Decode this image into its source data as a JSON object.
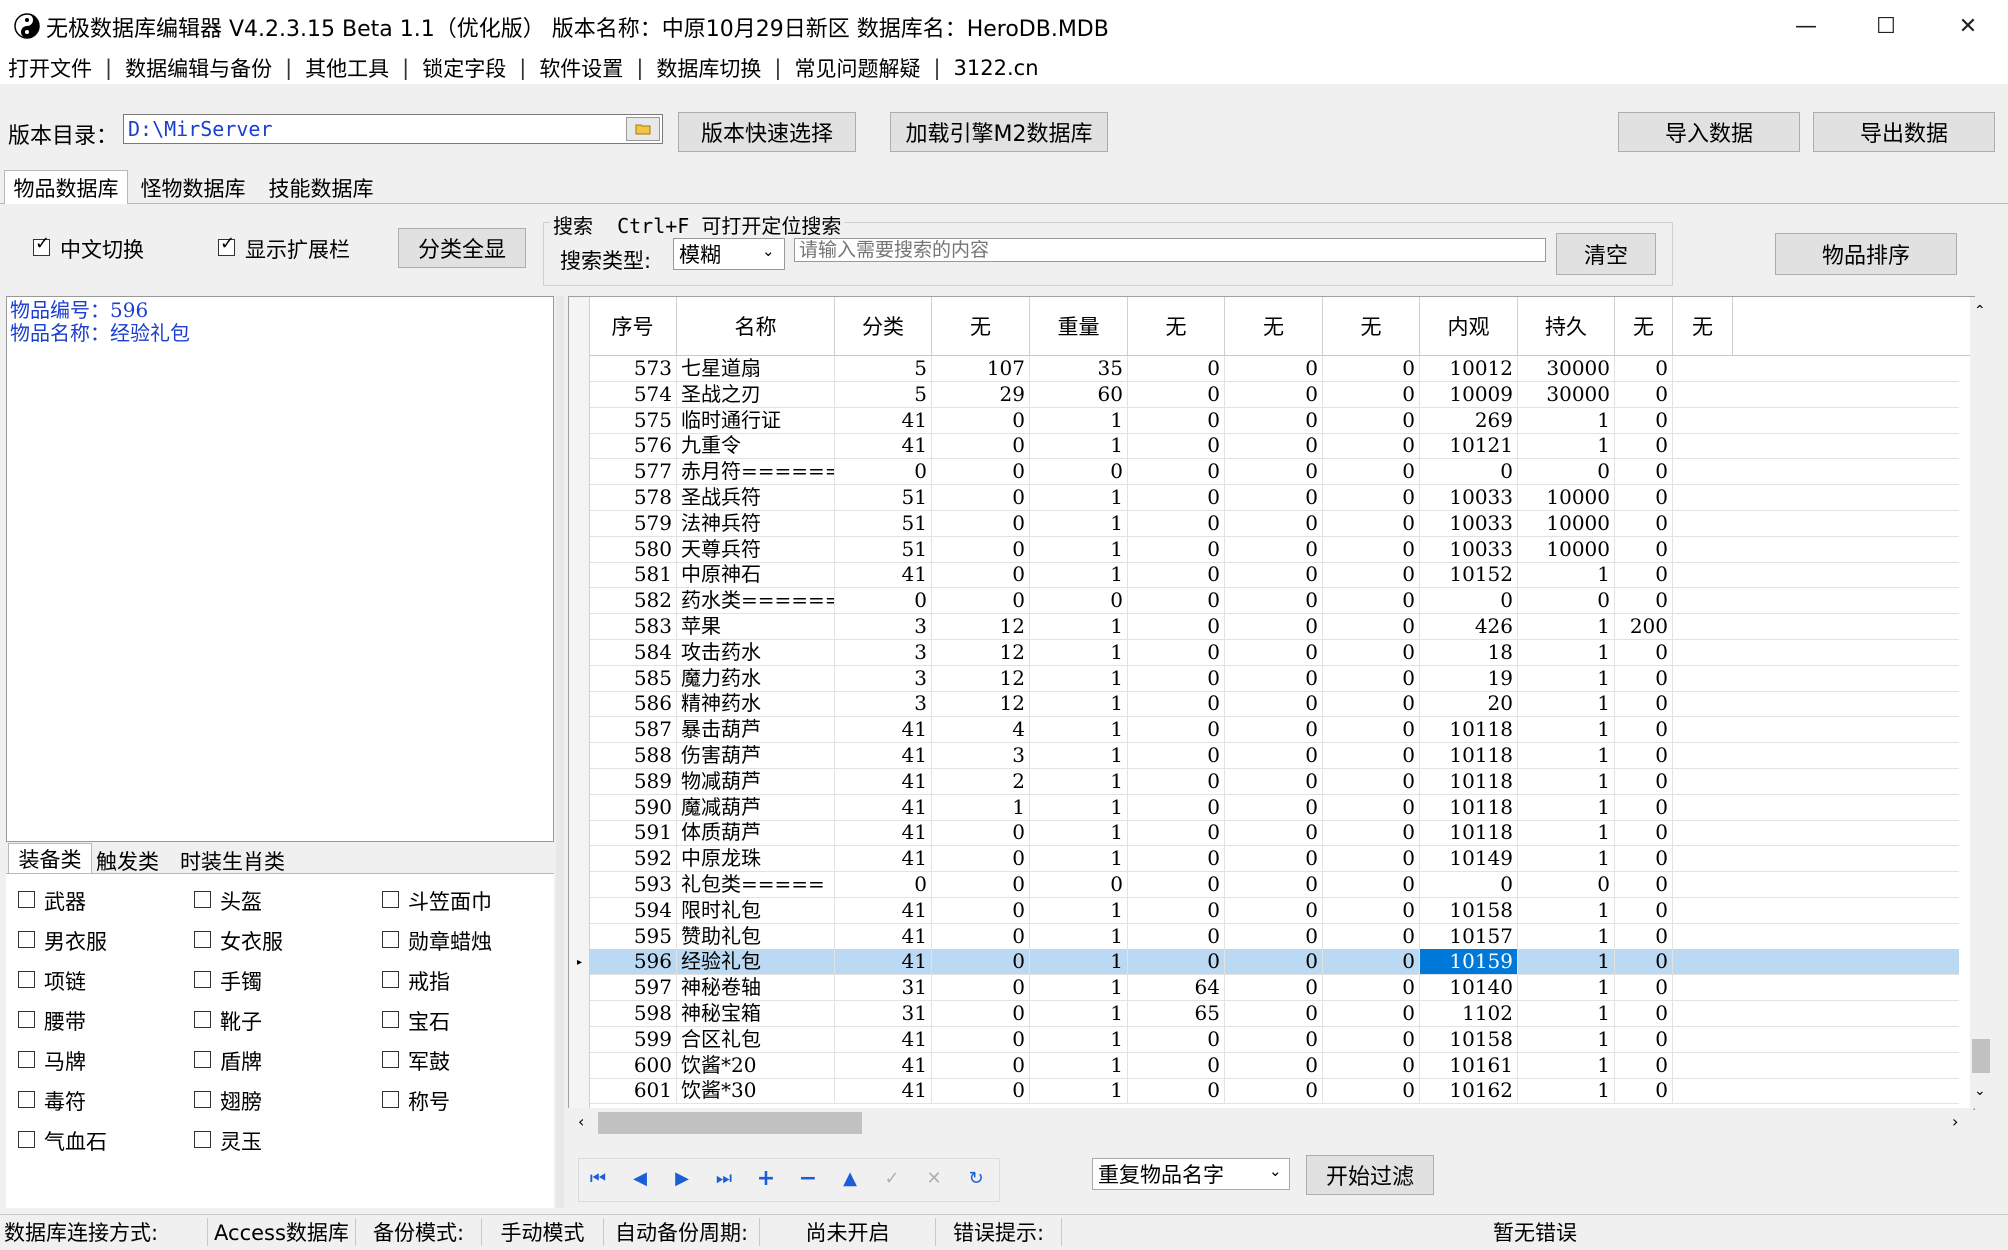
{
  "window": {
    "title": "无极数据库编辑器 V4.2.3.15    Beta 1.1（优化版）    版本名称：中原10月29日新区    数据库名：HeroDB.MDB",
    "minimize": "—",
    "maximize": "☐",
    "close": "✕"
  },
  "menu": [
    "打开文件",
    "数据编辑与备份",
    "其他工具",
    "锁定字段",
    "软件设置",
    "数据库切换",
    "常见问题解疑",
    "3122.cn"
  ],
  "toolbar": {
    "version_dir_label": "版本目录：",
    "version_dir_value": "D:\\MirServer",
    "quick_select": "版本快速选择",
    "load_m2": "加载引擎M2数据库",
    "import": "导入数据",
    "export": "导出数据"
  },
  "tabs": [
    "物品数据库",
    "怪物数据库",
    "技能数据库"
  ],
  "options": {
    "chinese_switch": "中文切换",
    "show_ext": "显示扩展栏",
    "show_all_cat": "分类全显",
    "search_title": "搜索  Ctrl+F 可打开定位搜索",
    "search_type_label": "搜索类型:",
    "search_type_value": "模糊",
    "search_placeholder": "请输入需要搜索的内容",
    "clear": "清空",
    "sort": "物品排序"
  },
  "detail": {
    "line1": "物品编号：596",
    "line2": "物品名称：经验礼包"
  },
  "cat_tabs": [
    "装备类",
    "触发类",
    "时装生肖类"
  ],
  "categories": [
    "武器",
    "头盔",
    "斗笠面巾",
    "男衣服",
    "女衣服",
    "勋章蜡烛",
    "项链",
    "手镯",
    "戒指",
    "腰带",
    "靴子",
    "宝石",
    "马牌",
    "盾牌",
    "军鼓",
    "毒符",
    "翅膀",
    "称号",
    "气血石",
    "灵玉"
  ],
  "grid": {
    "headers": [
      "序号",
      "名称",
      "分类",
      "无",
      "重量",
      "无",
      "无",
      "无",
      "内观",
      "持久",
      "无",
      "无"
    ],
    "rows": [
      [
        "573",
        "七星道扇",
        "5",
        "107",
        "35",
        "0",
        "0",
        "0",
        "10012",
        "30000",
        "0"
      ],
      [
        "574",
        "圣战之刃",
        "5",
        "29",
        "60",
        "0",
        "0",
        "0",
        "10009",
        "30000",
        "0"
      ],
      [
        "575",
        "临时通行证",
        "41",
        "0",
        "1",
        "0",
        "0",
        "0",
        "269",
        "1",
        "0"
      ],
      [
        "576",
        "九重令",
        "41",
        "0",
        "1",
        "0",
        "0",
        "0",
        "10121",
        "1",
        "0"
      ],
      [
        "577",
        "赤月符======",
        "0",
        "0",
        "0",
        "0",
        "0",
        "0",
        "0",
        "0",
        "0"
      ],
      [
        "578",
        "圣战兵符",
        "51",
        "0",
        "1",
        "0",
        "0",
        "0",
        "10033",
        "10000",
        "0"
      ],
      [
        "579",
        "法神兵符",
        "51",
        "0",
        "1",
        "0",
        "0",
        "0",
        "10033",
        "10000",
        "0"
      ],
      [
        "580",
        "天尊兵符",
        "51",
        "0",
        "1",
        "0",
        "0",
        "0",
        "10033",
        "10000",
        "0"
      ],
      [
        "581",
        "中原神石",
        "41",
        "0",
        "1",
        "0",
        "0",
        "0",
        "10152",
        "1",
        "0"
      ],
      [
        "582",
        "药水类======",
        "0",
        "0",
        "0",
        "0",
        "0",
        "0",
        "0",
        "0",
        "0"
      ],
      [
        "583",
        "苹果",
        "3",
        "12",
        "1",
        "0",
        "0",
        "0",
        "426",
        "1",
        "200"
      ],
      [
        "584",
        "攻击药水",
        "3",
        "12",
        "1",
        "0",
        "0",
        "0",
        "18",
        "1",
        "0"
      ],
      [
        "585",
        "魔力药水",
        "3",
        "12",
        "1",
        "0",
        "0",
        "0",
        "19",
        "1",
        "0"
      ],
      [
        "586",
        "精神药水",
        "3",
        "12",
        "1",
        "0",
        "0",
        "0",
        "20",
        "1",
        "0"
      ],
      [
        "587",
        "暴击葫芦",
        "41",
        "4",
        "1",
        "0",
        "0",
        "0",
        "10118",
        "1",
        "0"
      ],
      [
        "588",
        "伤害葫芦",
        "41",
        "3",
        "1",
        "0",
        "0",
        "0",
        "10118",
        "1",
        "0"
      ],
      [
        "589",
        "物减葫芦",
        "41",
        "2",
        "1",
        "0",
        "0",
        "0",
        "10118",
        "1",
        "0"
      ],
      [
        "590",
        "魔减葫芦",
        "41",
        "1",
        "1",
        "0",
        "0",
        "0",
        "10118",
        "1",
        "0"
      ],
      [
        "591",
        "体质葫芦",
        "41",
        "0",
        "1",
        "0",
        "0",
        "0",
        "10118",
        "1",
        "0"
      ],
      [
        "592",
        "中原龙珠",
        "41",
        "0",
        "1",
        "0",
        "0",
        "0",
        "10149",
        "1",
        "0"
      ],
      [
        "593",
        "礼包类=====",
        "0",
        "0",
        "0",
        "0",
        "0",
        "0",
        "0",
        "0",
        "0"
      ],
      [
        "594",
        "限时礼包",
        "41",
        "0",
        "1",
        "0",
        "0",
        "0",
        "10158",
        "1",
        "0"
      ],
      [
        "595",
        "赞助礼包",
        "41",
        "0",
        "1",
        "0",
        "0",
        "0",
        "10157",
        "1",
        "0"
      ],
      [
        "596",
        "经验礼包",
        "41",
        "0",
        "1",
        "0",
        "0",
        "0",
        "10159",
        "1",
        "0"
      ],
      [
        "597",
        "神秘卷轴",
        "31",
        "0",
        "1",
        "64",
        "0",
        "0",
        "10140",
        "1",
        "0"
      ],
      [
        "598",
        "神秘宝箱",
        "31",
        "0",
        "1",
        "65",
        "0",
        "0",
        "1102",
        "1",
        "0"
      ],
      [
        "599",
        "合区礼包",
        "41",
        "0",
        "1",
        "0",
        "0",
        "0",
        "10158",
        "1",
        "0"
      ],
      [
        "600",
        "饮酱*20",
        "41",
        "0",
        "1",
        "0",
        "0",
        "0",
        "10161",
        "1",
        "0"
      ],
      [
        "601",
        "饮酱*30",
        "41",
        "0",
        "1",
        "0",
        "0",
        "0",
        "10162",
        "1",
        "0"
      ]
    ],
    "selected_id": "596"
  },
  "filter": {
    "select_value": "重复物品名字",
    "start": "开始过滤"
  },
  "status": {
    "conn_label": "数据库连接方式:",
    "conn_value": "Access数据库",
    "backup_label": "备份模式:",
    "backup_value": "手动模式",
    "auto_label": "自动备份周期:",
    "auto_value": "尚未开启",
    "err_label": "错误提示:",
    "err_value": "暂无错误"
  }
}
